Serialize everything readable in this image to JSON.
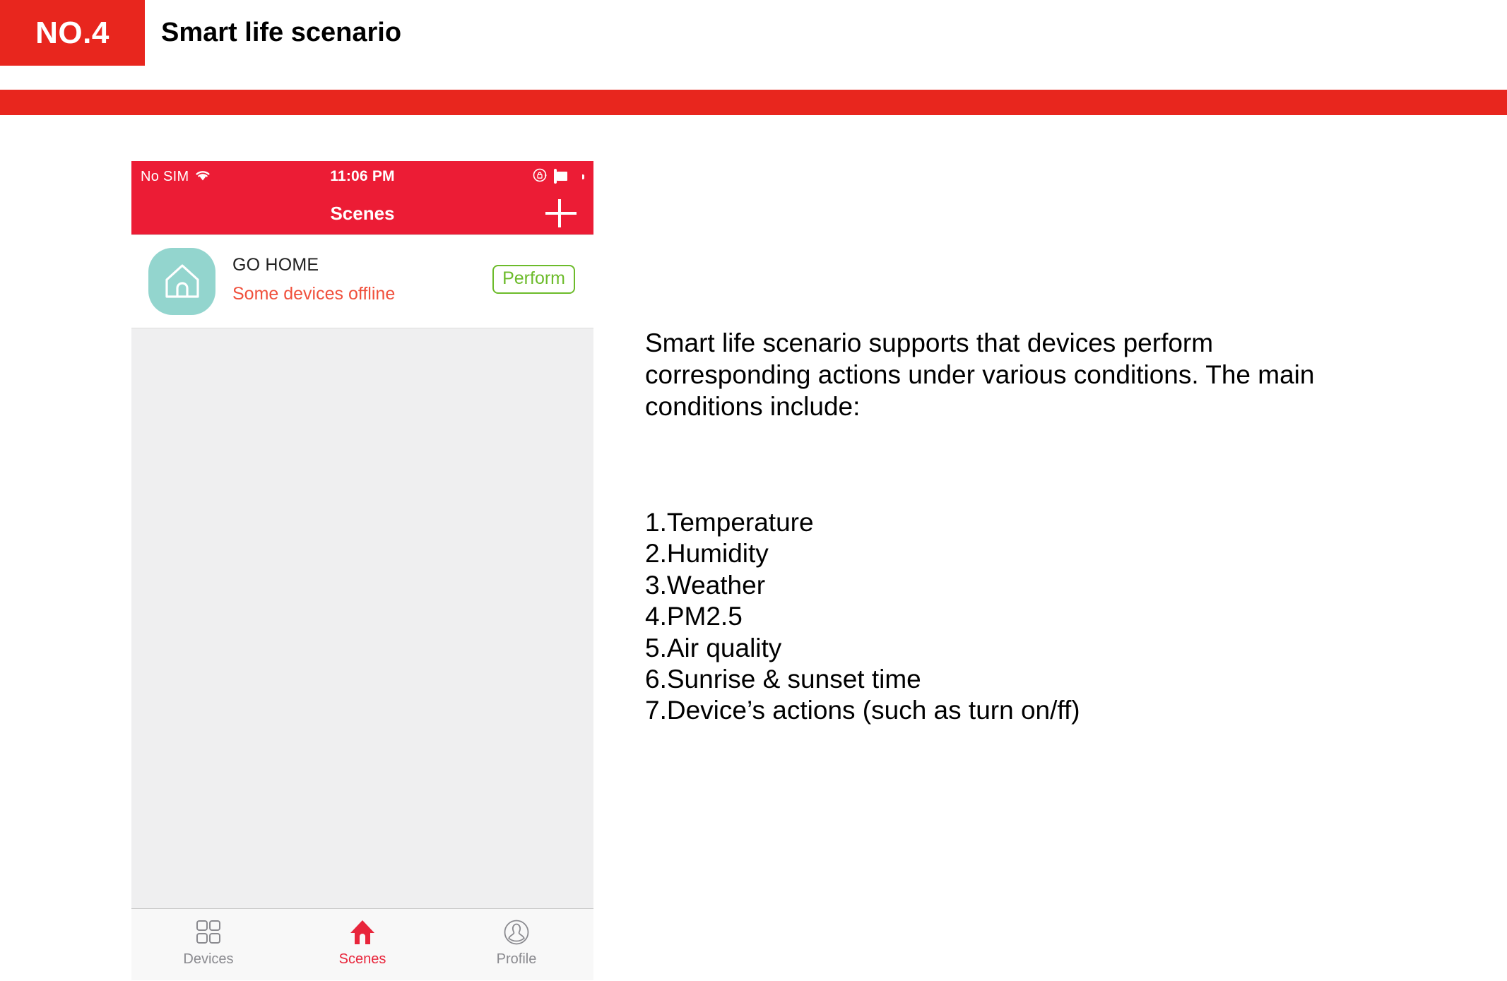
{
  "slide": {
    "number_badge": "NO.4",
    "title": "Smart life scenario",
    "accent_color": "#e8261e"
  },
  "phone": {
    "status_bar": {
      "carrier": "No SIM",
      "wifi_icon": "wifi-icon",
      "time": "11:06 PM",
      "rotation_lock_icon": "rotation-lock-icon",
      "battery_icon": "battery-icon",
      "background_color": "#ec1c35"
    },
    "nav_bar": {
      "title": "Scenes",
      "add_button_icon": "plus-icon",
      "background_color": "#ec1c35"
    },
    "scenes": [
      {
        "name": "GO HOME",
        "status": "Some devices offline",
        "status_color": "#f0503c",
        "icon": "house-icon",
        "icon_background": "#93d5ce",
        "action_label": "Perform",
        "action_color": "#6cbb2a"
      }
    ],
    "tab_bar": {
      "items": [
        {
          "label": "Devices",
          "icon": "grid-icon",
          "active": false
        },
        {
          "label": "Scenes",
          "icon": "house-filled-icon",
          "active": true
        },
        {
          "label": "Profile",
          "icon": "person-circle-icon",
          "active": false
        }
      ],
      "active_color": "#e8253b",
      "inactive_color": "#8a8a8f"
    }
  },
  "content": {
    "paragraph": "Smart life scenario supports that devices perform corresponding actions under various conditions. The main conditions include:",
    "conditions": [
      "1.Temperature",
      "2.Humidity",
      "3.Weather",
      "4.PM2.5",
      "5.Air quality",
      "6.Sunrise & sunset time",
      "7.Device’s actions (such as turn on/ff)"
    ]
  }
}
